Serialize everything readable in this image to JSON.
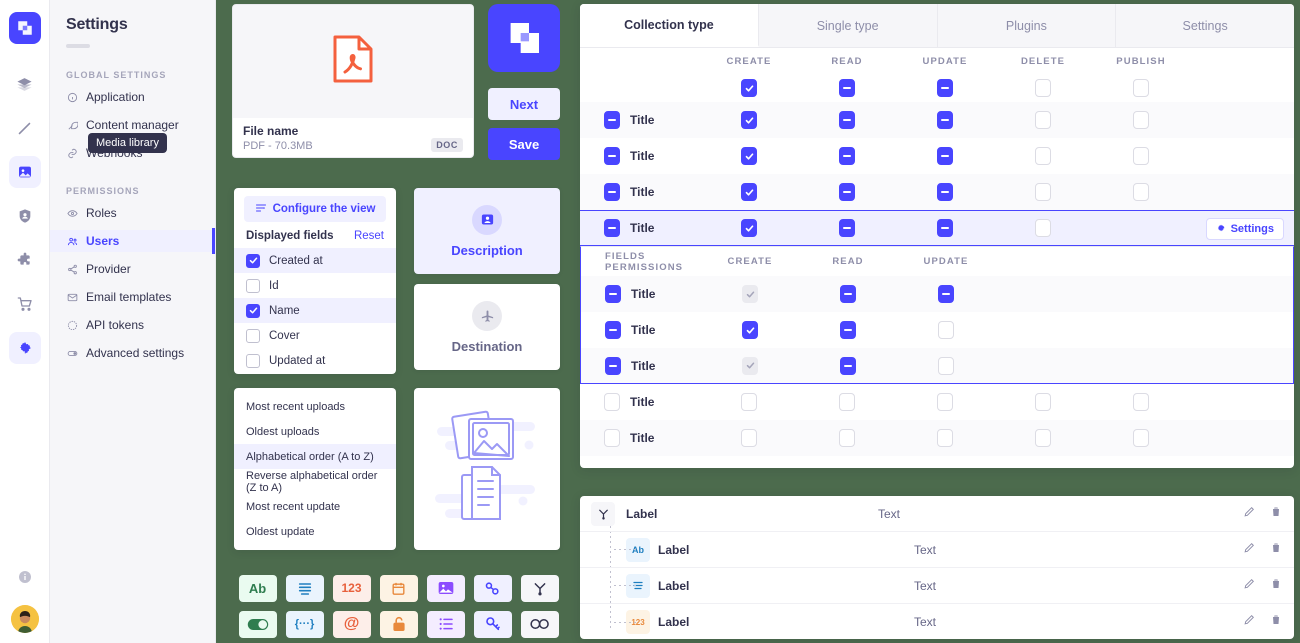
{
  "app": {
    "brand_color": "#4945ff",
    "background_color": "#4c6b4d"
  },
  "rail": {
    "logo_name": "strapi-logo",
    "items": [
      {
        "name": "content-type-builder",
        "icon": "layers-icon",
        "active": false
      },
      {
        "name": "content-manager",
        "icon": "pencil-icon",
        "active": false
      },
      {
        "name": "media-library",
        "icon": "image-icon",
        "active": true
      },
      {
        "name": "roles-permissions",
        "icon": "shield-icon",
        "active": false
      },
      {
        "name": "plugins",
        "icon": "puzzle-icon",
        "active": false
      },
      {
        "name": "marketplace",
        "icon": "cart-icon",
        "active": false
      },
      {
        "name": "settings",
        "icon": "gear-icon",
        "active": true
      }
    ],
    "bottom": [
      {
        "name": "help",
        "icon": "info-icon"
      },
      {
        "name": "profile",
        "icon": "avatar"
      }
    ]
  },
  "sidebar": {
    "title": "Settings",
    "tooltip": "Media library",
    "sections": [
      {
        "label": "GLOBAL SETTINGS",
        "items": [
          {
            "label": "Application",
            "icon": "info-circle-icon",
            "active": false
          },
          {
            "label": "Content manager",
            "icon": "feather-icon",
            "active": false
          },
          {
            "label": "Webhooks",
            "icon": "link-icon",
            "active": false
          }
        ]
      },
      {
        "label": "PERMISSIONS",
        "items": [
          {
            "label": "Roles",
            "icon": "eye-icon",
            "active": false
          },
          {
            "label": "Users",
            "icon": "users-icon",
            "active": true
          },
          {
            "label": "Provider",
            "icon": "share-icon",
            "active": false
          },
          {
            "label": "Email templates",
            "icon": "mail-icon",
            "active": false
          },
          {
            "label": "API tokens",
            "icon": "clock-icon",
            "active": false
          },
          {
            "label": "Advanced settings",
            "icon": "toggle-icon",
            "active": false
          }
        ]
      }
    ]
  },
  "file_card": {
    "preview_icon": "pdf-file-icon",
    "name": "File name",
    "meta": "PDF - 70.3MB",
    "tag": "DOC"
  },
  "buttons": {
    "next": "Next",
    "save": "Save"
  },
  "displayed_fields_card": {
    "configure_button": "Configure the view",
    "heading": "Displayed fields",
    "reset": "Reset",
    "fields": [
      {
        "label": "Created at",
        "checked": true
      },
      {
        "label": "Id",
        "checked": false
      },
      {
        "label": "Name",
        "checked": true
      },
      {
        "label": "Cover",
        "checked": false
      },
      {
        "label": "Updated at",
        "checked": false
      }
    ]
  },
  "sort_card": {
    "options": [
      {
        "label": "Most recent uploads",
        "selected": false
      },
      {
        "label": "Oldest uploads",
        "selected": false
      },
      {
        "label": "Alphabetical order (A to Z)",
        "selected": true
      },
      {
        "label": "Reverse alphabetical order (Z to A)",
        "selected": false
      },
      {
        "label": "Most recent update",
        "selected": false
      },
      {
        "label": "Oldest update",
        "selected": false
      }
    ]
  },
  "selection_cards": [
    {
      "label": "Description",
      "icon": "user-card-icon",
      "selected": true
    },
    {
      "label": "Destination",
      "icon": "plane-icon",
      "selected": false
    }
  ],
  "illustration_card": {
    "icon": "media-documents-illustration"
  },
  "icon_grid": [
    {
      "name": "text-field-icon",
      "glyph": "Ab",
      "fg": "#2f7d4f",
      "bg": "#eafbf0"
    },
    {
      "name": "rich-text-icon",
      "glyph": "☰",
      "fg": "#1f7fc0",
      "bg": "#eaf4fd"
    },
    {
      "name": "number-field-icon",
      "glyph": "123",
      "fg": "#e8603c",
      "bg": "#fdeee9"
    },
    {
      "name": "date-field-icon",
      "glyph": "▢",
      "fg": "#e8893c",
      "bg": "#fdf3e4"
    },
    {
      "name": "media-field-icon",
      "glyph": "Ὓc",
      "fg": "#8c4bff",
      "bg": "#f4edff"
    },
    {
      "name": "relation-field-icon",
      "glyph": "⚭",
      "fg": "#4945ff",
      "bg": "#f0f0ff"
    },
    {
      "name": "component-field-icon",
      "glyph": "⅄",
      "fg": "#32324d",
      "bg": "#f6f6f9"
    },
    {
      "name": "boolean-field-icon",
      "glyph": "●",
      "fg": "#2f7d4f",
      "bg": "#eafbf0"
    },
    {
      "name": "json-field-icon",
      "glyph": "{···}",
      "fg": "#1f7fc0",
      "bg": "#eaf4fd"
    },
    {
      "name": "email-field-icon",
      "glyph": "@",
      "fg": "#e8603c",
      "bg": "#fdeee9"
    },
    {
      "name": "password-field-icon",
      "glyph": "⚿",
      "fg": "#e8893c",
      "bg": "#fdf3e4"
    },
    {
      "name": "enumeration-field-icon",
      "glyph": "☰",
      "fg": "#8c4bff",
      "bg": "#f4edff"
    },
    {
      "name": "uid-field-icon",
      "glyph": "⚷",
      "fg": "#4945ff",
      "bg": "#f0f0ff"
    },
    {
      "name": "dynamic-zone-icon",
      "glyph": "∞",
      "fg": "#32324d",
      "bg": "#f6f6f9"
    }
  ],
  "permissions": {
    "tabs": [
      {
        "label": "Collection type",
        "active": true
      },
      {
        "label": "Single type",
        "active": false
      },
      {
        "label": "Plugins",
        "active": false
      },
      {
        "label": "Settings",
        "active": false
      }
    ],
    "columns": [
      "CREATE",
      "READ",
      "UPDATE",
      "DELETE",
      "PUBLISH"
    ],
    "header_states": [
      "check",
      "dash",
      "dash",
      "empty",
      "empty"
    ],
    "rows": [
      {
        "label": "Title",
        "toggle": "dash",
        "states": [
          "check",
          "dash",
          "dash",
          "empty",
          "empty"
        ],
        "selected": false
      },
      {
        "label": "Title",
        "toggle": "dash",
        "states": [
          "check",
          "dash",
          "dash",
          "empty",
          "empty"
        ],
        "selected": false
      },
      {
        "label": "Title",
        "toggle": "dash",
        "states": [
          "check",
          "dash",
          "dash",
          "empty",
          "empty"
        ],
        "selected": false
      },
      {
        "label": "Title",
        "toggle": "dash",
        "states": [
          "check",
          "dash",
          "dash",
          "empty",
          "none"
        ],
        "selected": true,
        "settings_button": "Settings"
      }
    ],
    "fields_section": {
      "label": "FIELDS PERMISSIONS",
      "columns": [
        "CREATE",
        "READ",
        "UPDATE"
      ],
      "rows": [
        {
          "label": "Title",
          "toggle": "dash",
          "states": [
            "disabled-check",
            "dash",
            "dash"
          ]
        },
        {
          "label": "Title",
          "toggle": "dash",
          "states": [
            "check",
            "dash",
            "empty"
          ]
        },
        {
          "label": "Title",
          "toggle": "dash",
          "states": [
            "disabled-check",
            "dash",
            "empty"
          ]
        }
      ]
    },
    "trailing_rows": [
      {
        "label": "Title",
        "toggle": "empty",
        "states": [
          "empty",
          "empty",
          "empty",
          "empty",
          "empty"
        ]
      },
      {
        "label": "Title",
        "toggle": "empty",
        "states": [
          "empty",
          "empty",
          "empty",
          "empty",
          "empty"
        ]
      }
    ]
  },
  "list_panel": {
    "rows": [
      {
        "label": "Label",
        "value": "Text",
        "icon": "relation-icon",
        "icon_glyph": "⅄",
        "indent": 0,
        "fg": "#32324d",
        "bg": "#f6f6f9"
      },
      {
        "label": "Label",
        "value": "Text",
        "icon": "text-icon",
        "icon_glyph": "Ab",
        "indent": 1,
        "fg": "#1f7fc0",
        "bg": "#eaf4fd"
      },
      {
        "label": "Label",
        "value": "Text",
        "icon": "rich-text-icon",
        "icon_glyph": "☰",
        "indent": 1,
        "fg": "#1f7fc0",
        "bg": "#eaf4fd"
      },
      {
        "label": "Label",
        "value": "Text",
        "icon": "number-icon",
        "icon_glyph": "123",
        "indent": 1,
        "fg": "#e8893c",
        "bg": "#fdf3e4"
      }
    ],
    "actions": [
      {
        "name": "edit-icon",
        "glyph": "✒"
      },
      {
        "name": "delete-icon",
        "glyph": "Ὕ1"
      }
    ]
  }
}
